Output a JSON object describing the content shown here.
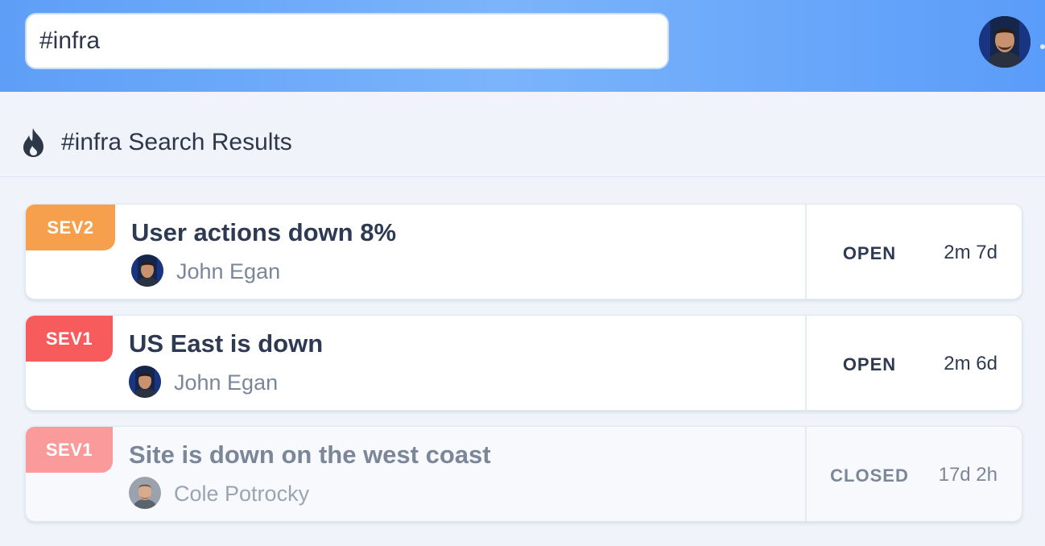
{
  "search": {
    "value": "#infra"
  },
  "results": {
    "title": "#infra Search Results"
  },
  "incidents": [
    {
      "severity": "SEV2",
      "severity_color": "#f6a04d",
      "title": "User actions down 8%",
      "author": "John Egan",
      "status": "OPEN",
      "age": "2m 7d"
    },
    {
      "severity": "SEV1",
      "severity_color": "#f85b5b",
      "title": "US East is down",
      "author": "John Egan",
      "status": "OPEN",
      "age": "2m 6d"
    },
    {
      "severity": "SEV1",
      "severity_color": "#fb9a9a",
      "title": "Site is down on the west coast",
      "author": "Cole Potrocky",
      "status": "CLOSED",
      "age": "17d 2h"
    }
  ],
  "icons": {
    "results_icon": "fire-icon",
    "profile": "avatar"
  }
}
